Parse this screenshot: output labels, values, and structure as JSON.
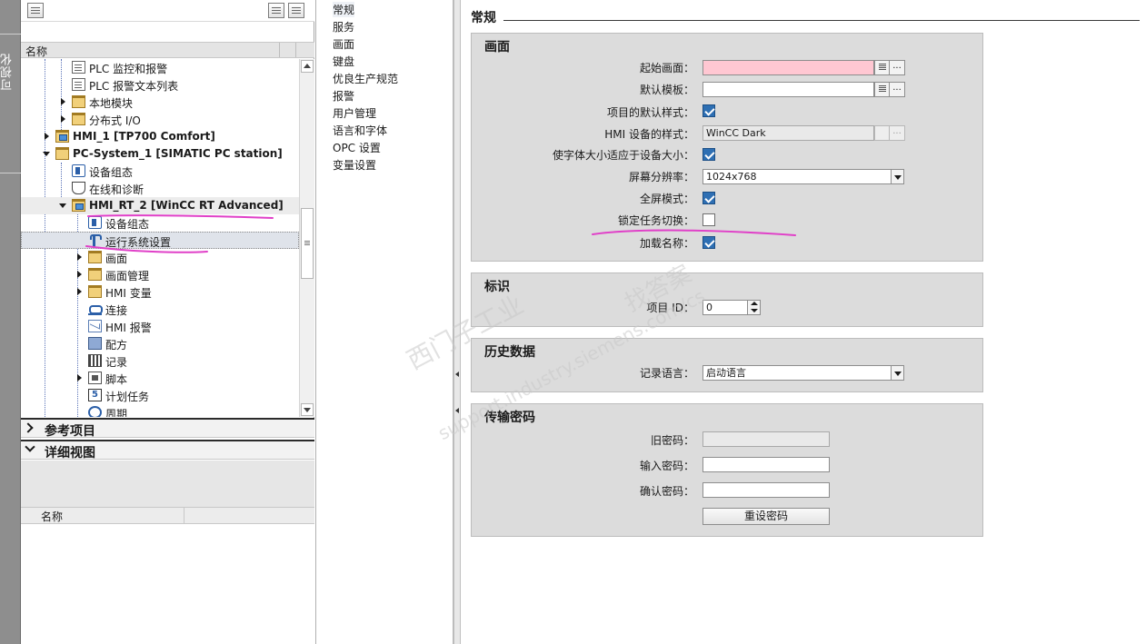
{
  "side_tab": {
    "label": "可视化"
  },
  "project_tree": {
    "header_name": "名称",
    "items": [
      {
        "label": "PLC 监控和报警",
        "icon": "doc-icon",
        "bold": false
      },
      {
        "label": "PLC 报警文本列表",
        "icon": "doc-icon",
        "bold": false
      },
      {
        "label": "本地模块",
        "icon": "folder-icon",
        "bold": false
      },
      {
        "label": "分布式 I/O",
        "icon": "folder-icon",
        "bold": false
      },
      {
        "label": "HMI_1 [TP700 Comfort]",
        "icon": "hmi-folder-icon",
        "bold": true
      },
      {
        "label": "PC-System_1 [SIMATIC PC station]",
        "icon": "folder-icon",
        "bold": true
      },
      {
        "label": "设备组态",
        "icon": "device-config-icon",
        "bold": false
      },
      {
        "label": "在线和诊断",
        "icon": "diagnostics-icon",
        "bold": false
      },
      {
        "label": "HMI_RT_2 [WinCC RT Advanced]",
        "icon": "hmi-folder-icon",
        "bold": true
      },
      {
        "label": "设备组态",
        "icon": "device-config-icon",
        "bold": false
      },
      {
        "label": "运行系统设置",
        "icon": "wrench-icon",
        "bold": false
      },
      {
        "label": "画面",
        "icon": "folder-icon",
        "bold": false
      },
      {
        "label": "画面管理",
        "icon": "folder-icon",
        "bold": false
      },
      {
        "label": "HMI 变量",
        "icon": "folder-icon",
        "bold": false
      },
      {
        "label": "连接",
        "icon": "connection-icon",
        "bold": false
      },
      {
        "label": "HMI 报警",
        "icon": "mail-icon",
        "bold": false
      },
      {
        "label": "配方",
        "icon": "recipe-icon",
        "bold": false
      },
      {
        "label": "记录",
        "icon": "log-icon",
        "bold": false
      },
      {
        "label": "脚本",
        "icon": "script-icon",
        "bold": false
      },
      {
        "label": "计划任务",
        "icon": "schedule-icon",
        "bold": false
      },
      {
        "label": "周期",
        "icon": "cycle-icon",
        "bold": false
      }
    ]
  },
  "reference_section": {
    "label": "参考项目"
  },
  "detail_section": {
    "label": "详细视图",
    "header_name": "名称"
  },
  "nav": {
    "items": [
      "常规",
      "服务",
      "画面",
      "键盘",
      "优良生产规范",
      "报警",
      "用户管理",
      "语言和字体",
      "OPC 设置",
      "变量设置"
    ],
    "active_index": 0
  },
  "content": {
    "title": "常规",
    "group_screen": {
      "title": "画面",
      "start_screen_label": "起始画面：",
      "start_screen_value": "",
      "default_template_label": "默认模板：",
      "default_template_value": "",
      "browse_label": "...",
      "project_default_style_label": "项目的默认样式：",
      "project_default_style_checked": true,
      "hmi_style_label": "HMI 设备的样式：",
      "hmi_style_value": "WinCC Dark",
      "font_scale_label": "使字体大小适应于设备大小：",
      "font_scale_checked": true,
      "resolution_label": "屏幕分辨率：",
      "resolution_value": "1024x768",
      "fullscreen_label": "全屏模式：",
      "fullscreen_checked": true,
      "lock_task_switch_label": "锁定任务切换：",
      "lock_task_switch_checked": false,
      "load_names_label": "加载名称：",
      "load_names_checked": true
    },
    "group_identification": {
      "title": "标识",
      "project_id_label": "项目 ID：",
      "project_id_value": "0"
    },
    "group_history": {
      "title": "历史数据",
      "log_language_label": "记录语言：",
      "log_language_value": "启动语言"
    },
    "group_password": {
      "title": "传输密码",
      "old_password_label": "旧密码：",
      "old_password_value": "",
      "enter_password_label": "输入密码：",
      "enter_password_value": "",
      "confirm_password_label": "确认密码：",
      "confirm_password_value": "",
      "reset_button_label": "重设密码"
    }
  },
  "watermark": {
    "line1": "西门子工业",
    "line2": "support.industry.siemens.com/cs",
    "line3": "找答案"
  },
  "colors": {
    "annotation": "#e040c8",
    "accent": "#2e6fb3",
    "required_field": "#ffc7d2"
  }
}
